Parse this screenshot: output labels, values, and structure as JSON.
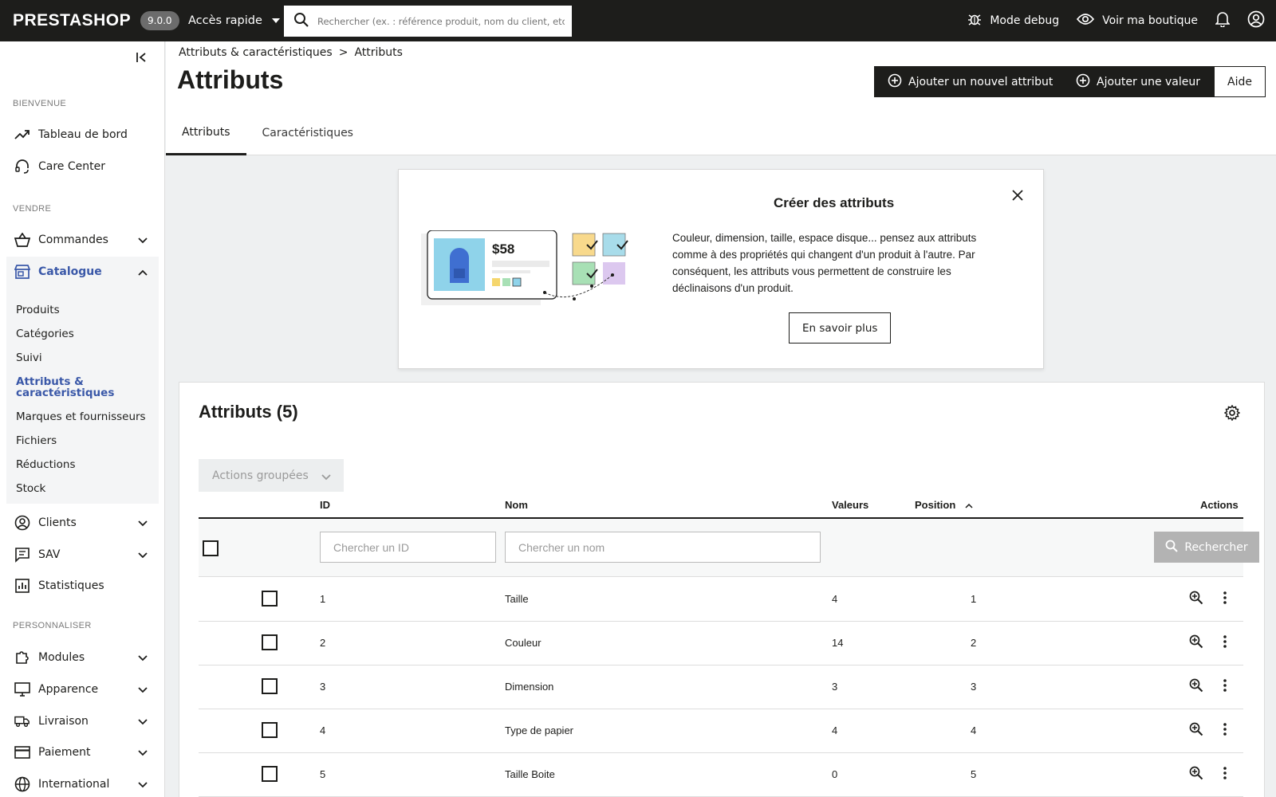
{
  "topbar": {
    "logo": "PRESTASHOP",
    "version": "9.0.0",
    "quick_access": "Accès rapide",
    "search_placeholder": "Rechercher (ex. : référence produit, nom du client, etc.)",
    "debug_label": "Mode debug",
    "shop_label": "Voir ma boutique"
  },
  "sidebar": {
    "sections": {
      "welcome": "BIENVENUE",
      "sell": "VENDRE",
      "customize": "PERSONNALISER"
    },
    "items": {
      "dashboard": "Tableau de bord",
      "care": "Care Center",
      "orders": "Commandes",
      "catalog": "Catalogue",
      "clients": "Clients",
      "sav": "SAV",
      "stats": "Statistiques",
      "modules": "Modules",
      "appearance": "Apparence",
      "shipping": "Livraison",
      "payment": "Paiement",
      "international": "International"
    },
    "catalog_sub": [
      "Produits",
      "Catégories",
      "Suivi",
      "Attributs & caractéristiques",
      "Marques et fournisseurs",
      "Fichiers",
      "Réductions",
      "Stock"
    ]
  },
  "header": {
    "breadcrumb": [
      "Attributs & caractéristiques",
      "Attributs"
    ],
    "breadcrumb_sep": ">",
    "title": "Attributs",
    "btn_add_attribute": "Ajouter un nouvel attribut",
    "btn_add_value": "Ajouter une valeur",
    "btn_help": "Aide",
    "tabs": [
      "Attributs",
      "Caractéristiques"
    ]
  },
  "promo": {
    "title": "Créer des attributs",
    "text": "Couleur, dimension, taille, espace disque... pensez aux attributs comme à des propriétés qui changent d'un produit à l'autre. Par conséquent, les attributs vous permettent de construire les déclinaisons d'un produit.",
    "button": "En savoir plus",
    "price": "$58"
  },
  "table": {
    "title": "Attributs (5)",
    "bulk_actions": "Actions groupées",
    "columns": [
      "ID",
      "Nom",
      "Valeurs",
      "Position",
      "Actions"
    ],
    "filter_id_placeholder": "Chercher un ID",
    "filter_name_placeholder": "Chercher un nom",
    "search_button": "Rechercher",
    "rows": [
      {
        "id": "1",
        "name": "Taille",
        "values": "4",
        "position": "1"
      },
      {
        "id": "2",
        "name": "Couleur",
        "values": "14",
        "position": "2"
      },
      {
        "id": "3",
        "name": "Dimension",
        "values": "3",
        "position": "3"
      },
      {
        "id": "4",
        "name": "Type de papier",
        "values": "4",
        "position": "4"
      },
      {
        "id": "5",
        "name": "Taille Boite",
        "values": "0",
        "position": "5"
      }
    ]
  },
  "colors": {
    "topbar": "#1d1d1b",
    "accent": "#3a58a8",
    "disabled_btn": "#b3b3b3"
  }
}
